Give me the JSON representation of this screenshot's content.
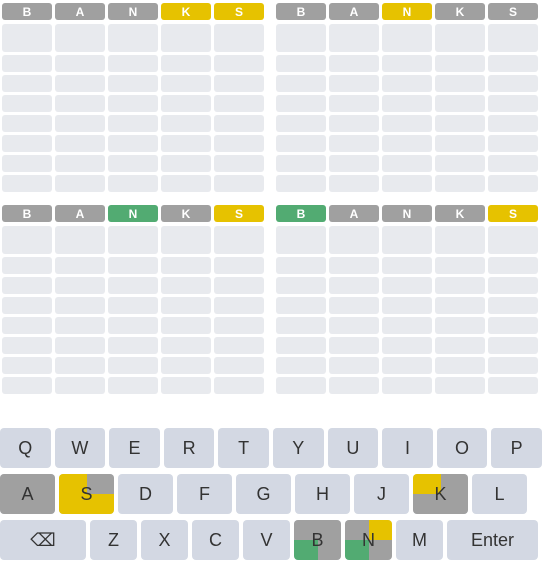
{
  "boards": [
    {
      "guess": [
        {
          "letter": "B",
          "state": "gray"
        },
        {
          "letter": "A",
          "state": "gray"
        },
        {
          "letter": "N",
          "state": "gray"
        },
        {
          "letter": "K",
          "state": "yellow"
        },
        {
          "letter": "S",
          "state": "yellow"
        }
      ]
    },
    {
      "guess": [
        {
          "letter": "B",
          "state": "gray"
        },
        {
          "letter": "A",
          "state": "gray"
        },
        {
          "letter": "N",
          "state": "yellow"
        },
        {
          "letter": "K",
          "state": "gray"
        },
        {
          "letter": "S",
          "state": "gray"
        }
      ]
    },
    {
      "guess": [
        {
          "letter": "B",
          "state": "gray"
        },
        {
          "letter": "A",
          "state": "gray"
        },
        {
          "letter": "N",
          "state": "green"
        },
        {
          "letter": "K",
          "state": "gray"
        },
        {
          "letter": "S",
          "state": "yellow"
        }
      ]
    },
    {
      "guess": [
        {
          "letter": "B",
          "state": "green"
        },
        {
          "letter": "A",
          "state": "gray"
        },
        {
          "letter": "N",
          "state": "gray"
        },
        {
          "letter": "K",
          "state": "gray"
        },
        {
          "letter": "S",
          "state": "yellow"
        }
      ]
    }
  ],
  "empty_rows_per_board": 8,
  "colors": {
    "gray": "#a0a0a0",
    "yellow": "#e6c200",
    "green": "#52ab72",
    "empty": "#e8eaee",
    "key": "#d3d8e3"
  },
  "keyboard": {
    "row1": [
      "Q",
      "W",
      "E",
      "R",
      "T",
      "Y",
      "U",
      "I",
      "O",
      "P"
    ],
    "row2": [
      "A",
      "S",
      "D",
      "F",
      "G",
      "H",
      "J",
      "K",
      "L"
    ],
    "row3": [
      "⌫",
      "Z",
      "X",
      "C",
      "V",
      "B",
      "N",
      "M",
      "Enter"
    ],
    "key_states": {
      "A": [
        "gray",
        "gray",
        "gray",
        "gray"
      ],
      "S": [
        "yellow",
        "gray",
        "yellow",
        "yellow"
      ],
      "K": [
        "yellow",
        "gray",
        "gray",
        "gray"
      ],
      "B": [
        "gray",
        "gray",
        "green",
        "gray"
      ],
      "N": [
        "gray",
        "yellow",
        "green",
        "gray"
      ]
    }
  }
}
